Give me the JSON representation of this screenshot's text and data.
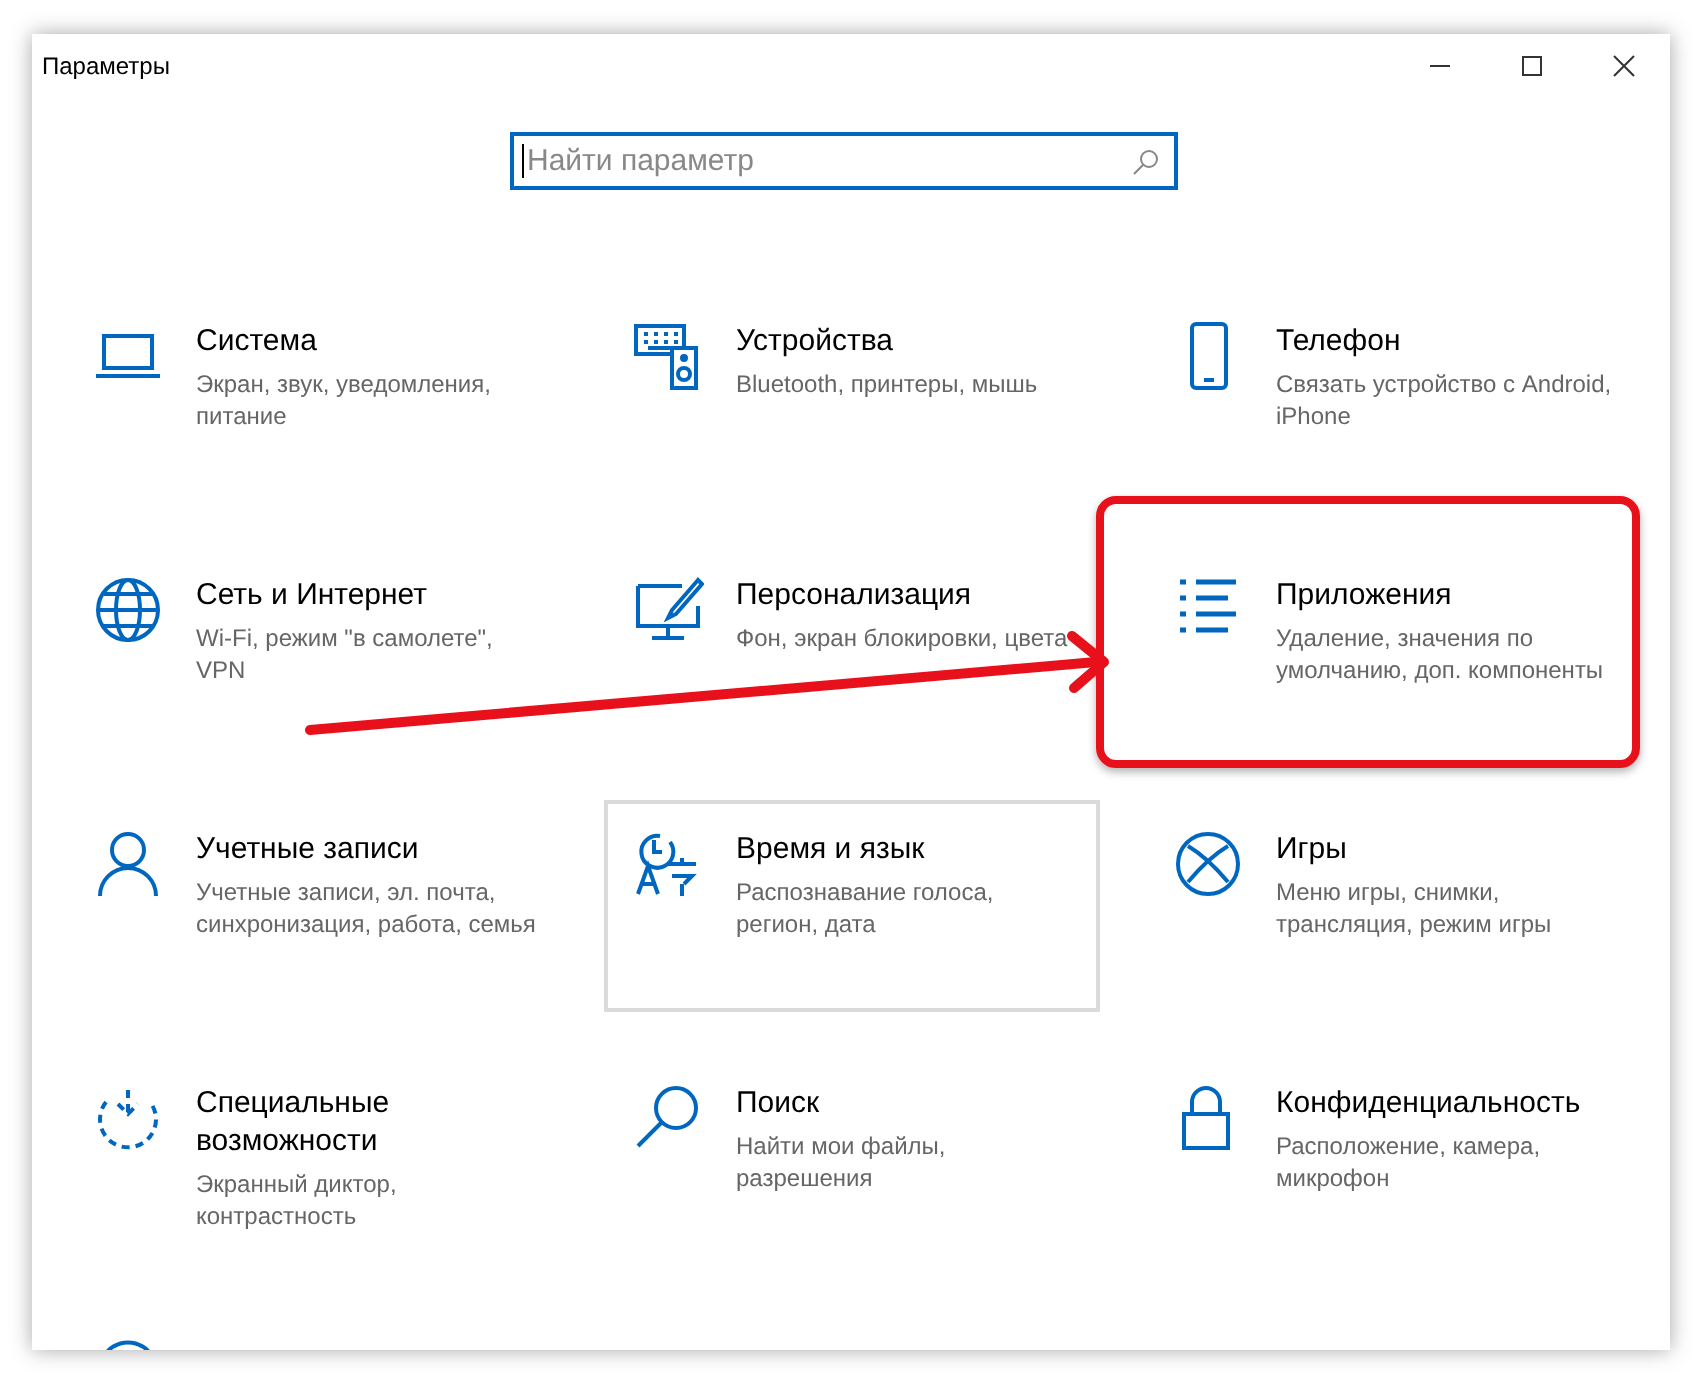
{
  "window": {
    "title": "Параметры"
  },
  "search": {
    "placeholder": "Найти параметр",
    "focused": true
  },
  "items": [
    {
      "title": "Система",
      "description": "Экран, звук, уведомления, питание",
      "hovered": false,
      "highlighted": false
    },
    {
      "title": "Устройства",
      "description": "Bluetooth, принтеры, мышь",
      "hovered": false,
      "highlighted": false
    },
    {
      "title": "Телефон",
      "description": "Связать устройство с Android, iPhone",
      "hovered": false,
      "highlighted": false
    },
    {
      "title": "Сеть и Интернет",
      "description": "Wi-Fi, режим \"в самолете\", VPN",
      "hovered": false,
      "highlighted": false
    },
    {
      "title": "Персонализация",
      "description": "Фон, экран блокировки, цвета",
      "hovered": false,
      "highlighted": false
    },
    {
      "title": "Приложения",
      "description": "Удаление, значения по умолчанию, доп. компоненты",
      "hovered": false,
      "highlighted": true
    },
    {
      "title": "Учетные записи",
      "description": "Учетные записи, эл. почта, синхронизация, работа, семья",
      "hovered": false,
      "highlighted": false
    },
    {
      "title": "Время и язык",
      "description": "Распознавание голоса, регион, дата",
      "hovered": true,
      "highlighted": false
    },
    {
      "title": "Игры",
      "description": "Меню игры, снимки, трансляция, режим игры",
      "hovered": false,
      "highlighted": false
    },
    {
      "title": "Специальные возможности",
      "description": "Экранный диктор, контрастность",
      "hovered": false,
      "highlighted": false
    },
    {
      "title": "Поиск",
      "description": "Найти мои файлы, разрешения",
      "hovered": false,
      "highlighted": false
    },
    {
      "title": "Конфиденциальность",
      "description": "Расположение, камера, микрофон",
      "hovered": false,
      "highlighted": false
    },
    {
      "kind": "cut"
    }
  ],
  "annotation": {
    "arrow": true
  }
}
